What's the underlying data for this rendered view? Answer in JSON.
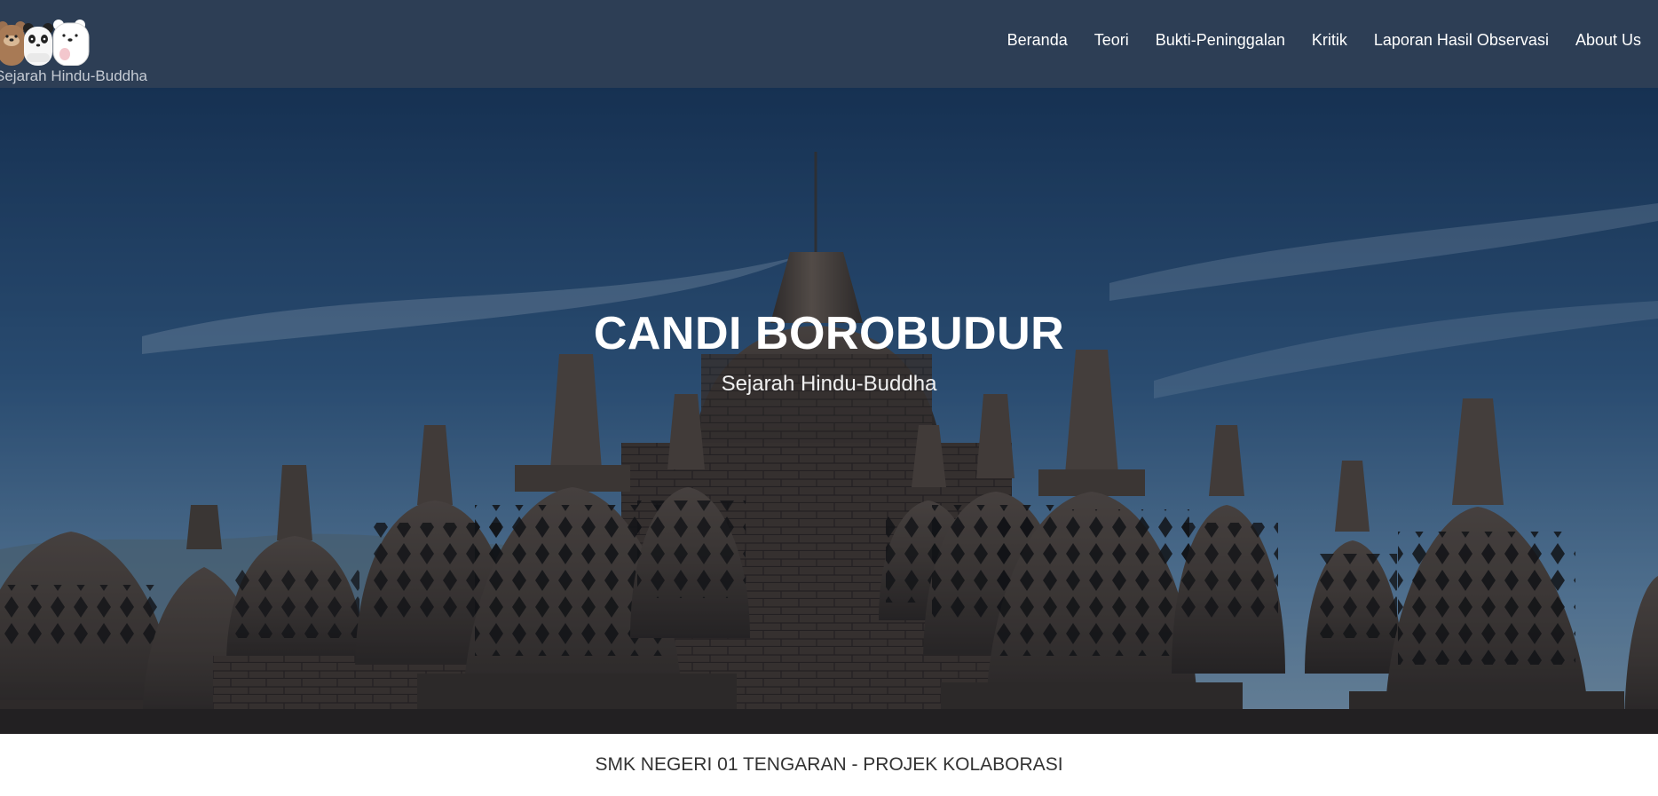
{
  "brand": {
    "logo_icon": "three-bears-icon",
    "name": "Sejarah Hindu-Buddha"
  },
  "nav": {
    "items": [
      "Beranda",
      "Teori",
      "Bukti-Peninggalan",
      "Kritik",
      "Laporan Hasil Observasi",
      "About Us"
    ]
  },
  "hero": {
    "title": "CANDI BOROBUDUR",
    "subtitle": "Sejarah Hindu-Buddha"
  },
  "footer": {
    "text": "SMK NEGERI 01 TENGARAN - PROJEK KOLABORASI"
  },
  "colors": {
    "header_bg": "#2d3e55",
    "nav_text": "#ffffff",
    "footer_text": "#333333"
  }
}
